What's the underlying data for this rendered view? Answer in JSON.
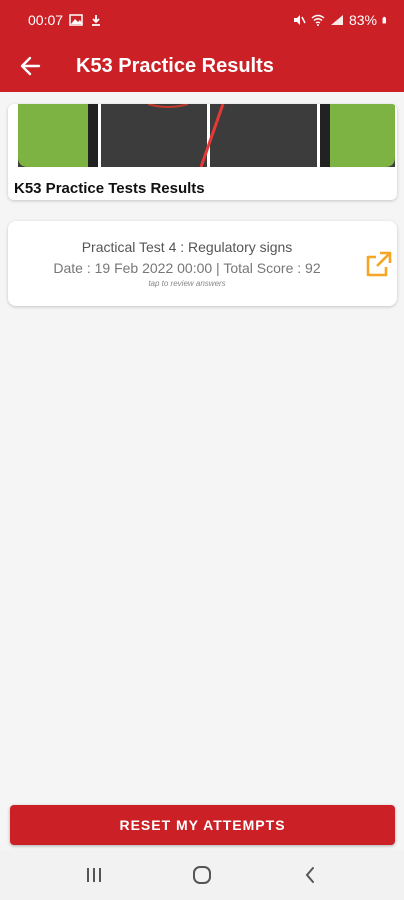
{
  "status_bar": {
    "time": "00:07",
    "battery": "83%"
  },
  "app_bar": {
    "title": "K53 Practice Results",
    "back_icon": "arrow-left-icon"
  },
  "banner": {
    "caption": "K53 Practice Tests Results"
  },
  "results": [
    {
      "title": "Practical Test 4 : Regulatory signs",
      "meta": "Date : 19 Feb 2022 00:00  | Total Score : 92",
      "hint": "tap to review answers",
      "icon": "open-external-icon"
    }
  ],
  "reset_button": {
    "label": "RESET MY ATTEMPTS"
  },
  "colors": {
    "primary": "#cc2027",
    "accent_icon": "#f5a623"
  }
}
